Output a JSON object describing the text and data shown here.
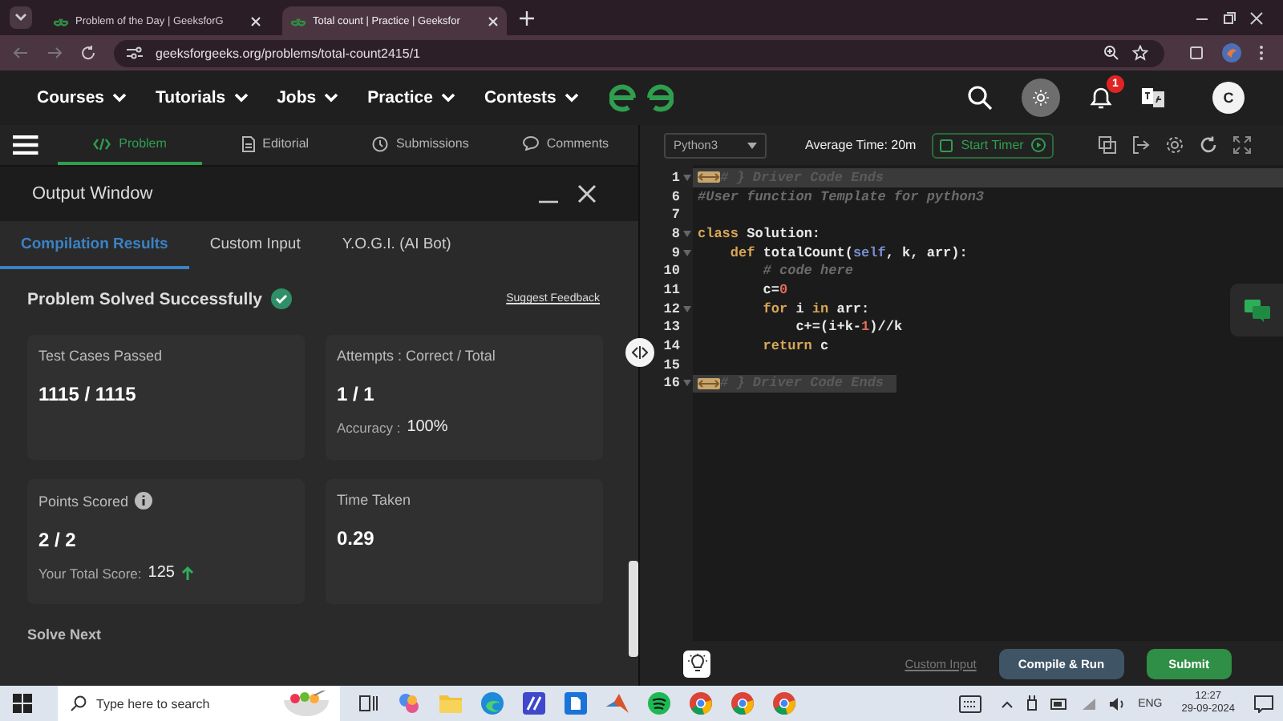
{
  "browser": {
    "tabs": [
      {
        "title": "Problem of the Day | GeeksforG",
        "selected": false
      },
      {
        "title": "Total count | Practice | Geeksfor",
        "selected": true
      }
    ],
    "url": "geeksforgeeks.org/problems/total-count2415/1"
  },
  "site_nav": {
    "menu": [
      "Courses",
      "Tutorials",
      "Jobs",
      "Practice",
      "Contests"
    ],
    "notification_count": "1",
    "avatar": "C"
  },
  "problem_tabs": [
    {
      "label": "Problem",
      "kind": "code",
      "selected": true
    },
    {
      "label": "Editorial",
      "kind": "doc",
      "selected": false
    },
    {
      "label": "Submissions",
      "kind": "clock",
      "selected": false
    },
    {
      "label": "Comments",
      "kind": "chat",
      "selected": false
    }
  ],
  "output_window": {
    "title": "Output Window",
    "tabs": [
      {
        "label": "Compilation Results",
        "selected": true
      },
      {
        "label": "Custom Input",
        "selected": false
      },
      {
        "label": "Y.O.G.I. (AI Bot)",
        "selected": false
      }
    ],
    "status": "Problem Solved Successfully",
    "feedback_link": "Suggest Feedback",
    "cards": [
      {
        "kind": "plain",
        "label": "Test Cases Passed",
        "value": "1115 / 1115"
      },
      {
        "kind": "accuracy",
        "label": "Attempts : Correct / Total",
        "value": "1 / 1",
        "detail_label": "Accuracy :",
        "detail_value": "100%"
      },
      {
        "kind": "score",
        "label": "Points Scored",
        "value": "2 / 2",
        "detail_label": "Your Total Score:",
        "detail_value": "125"
      },
      {
        "kind": "plain",
        "label": "Time Taken",
        "value": "0.29"
      }
    ],
    "solve_next": "Solve Next"
  },
  "editor": {
    "language": "Python3",
    "average_time": "Average Time: 20m",
    "timer_button": "Start Timer",
    "lines": [
      {
        "number": "1",
        "foldable": true,
        "tokens": [
          {
            "kind": "fold",
            "text": "# } Driver Code Ends"
          }
        ]
      },
      {
        "number": "6",
        "foldable": false,
        "tokens": [
          {
            "kind": "comment",
            "text": "#User function Template for python3"
          }
        ]
      },
      {
        "number": "7",
        "foldable": false
      },
      {
        "number": "8",
        "foldable": true,
        "tokens": [
          {
            "kind": "keyword",
            "text": "class"
          },
          {
            "kind": "plain",
            "text": " Solution:"
          }
        ]
      },
      {
        "number": "9",
        "foldable": true,
        "tokens": [
          {
            "kind": "keyword",
            "text": "    def"
          },
          {
            "kind": "plain",
            "text": " totalCount("
          },
          {
            "kind": "self",
            "text": "self"
          },
          {
            "kind": "plain",
            "text": ", k, arr):"
          }
        ]
      },
      {
        "number": "10",
        "foldable": false,
        "tokens": [
          {
            "kind": "comment",
            "text": "        # code here"
          }
        ]
      },
      {
        "number": "11",
        "foldable": false,
        "tokens": [
          {
            "kind": "plain",
            "text": "        c="
          },
          {
            "kind": "number",
            "text": "0"
          }
        ]
      },
      {
        "number": "12",
        "foldable": true,
        "tokens": [
          {
            "kind": "keyword",
            "text": "        for"
          },
          {
            "kind": "plain",
            "text": " i "
          },
          {
            "kind": "keyword",
            "text": "in"
          },
          {
            "kind": "plain",
            "text": " arr:"
          }
        ]
      },
      {
        "number": "13",
        "foldable": false,
        "tokens": [
          {
            "kind": "plain",
            "text": "            c+=(i+k-"
          },
          {
            "kind": "number",
            "text": "1"
          },
          {
            "kind": "plain",
            "text": ")//k"
          }
        ]
      },
      {
        "number": "14",
        "foldable": false,
        "tokens": [
          {
            "kind": "keyword",
            "text": "        return"
          },
          {
            "kind": "plain",
            "text": " c"
          }
        ]
      },
      {
        "number": "15",
        "foldable": false
      },
      {
        "number": "16",
        "foldable": true,
        "tokens": [
          {
            "kind": "fold",
            "text": "# } Driver Code Ends"
          }
        ]
      }
    ],
    "custom_input": "Custom Input",
    "compile_button": "Compile & Run",
    "submit_button": "Submit"
  },
  "taskbar": {
    "search_placeholder": "Type here to search",
    "language": "ENG",
    "time": "12:27",
    "date": "29-09-2024"
  }
}
